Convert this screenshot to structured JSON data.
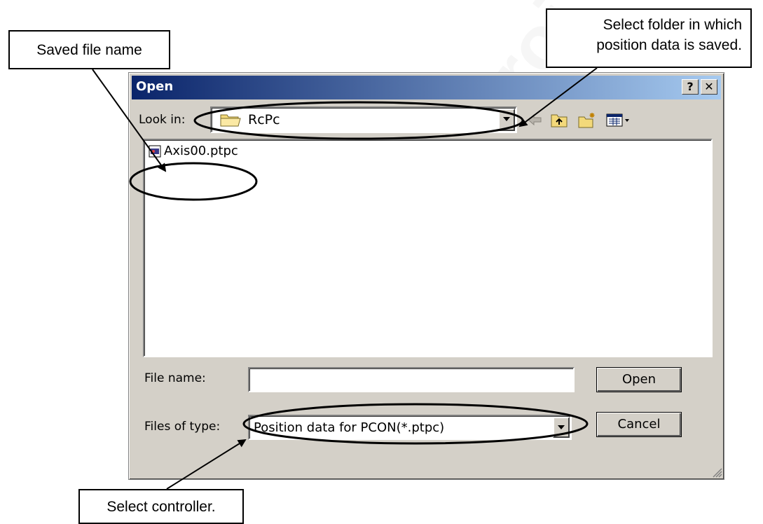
{
  "callouts": {
    "file_name": "Saved file name",
    "folder_line1": "Select folder in which",
    "folder_line2": "position data is saved.",
    "controller": "Select controller."
  },
  "dialog": {
    "title": "Open",
    "help_glyph": "?",
    "close_glyph": "✕",
    "look_in_label": "Look in:",
    "look_in_value": "RcPc",
    "files": [
      {
        "name": "Axis00.ptpc",
        "icon": "ptpc-file-icon"
      }
    ],
    "file_name_label": "File name:",
    "file_name_value": "",
    "files_of_type_label": "Files of type:",
    "files_of_type_value": "Position data for PCON(*.ptpc)",
    "open_label": "Open",
    "cancel_label": "Cancel"
  },
  "toolbar_icons": [
    "back-icon",
    "up-folder-icon",
    "new-folder-icon",
    "view-menu-icon"
  ],
  "watermark": "www.airoi",
  "colors": {
    "title_gradient_start": "#0a246a",
    "title_gradient_end": "#a6caf0",
    "dialog_face": "#d4d0c8"
  }
}
